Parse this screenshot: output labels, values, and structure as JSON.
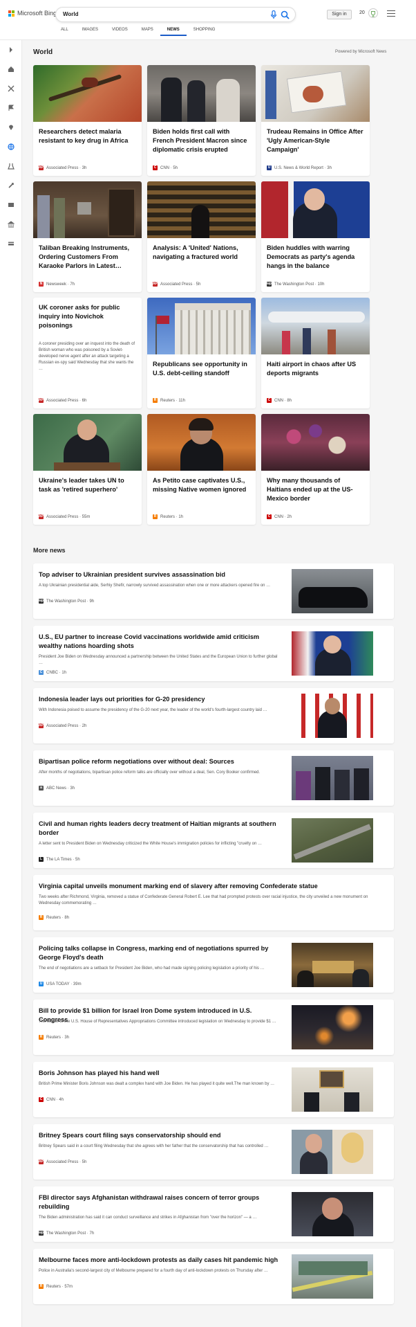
{
  "header": {
    "brand": "Microsoft Bing",
    "query": "World",
    "signin": "Sign in",
    "rewards": "20"
  },
  "tabs": [
    {
      "label": "ALL"
    },
    {
      "label": "IMAGES"
    },
    {
      "label": "VIDEOS"
    },
    {
      "label": "MAPS"
    },
    {
      "label": "NEWS"
    },
    {
      "label": "SHOPPING"
    }
  ],
  "active_tab": "NEWS",
  "section": {
    "title": "World",
    "powered": "Powered by Microsoft News"
  },
  "cards": [
    {
      "title": "Researchers detect malaria resistant to key drug in Africa",
      "source": "Associated Press · 3h",
      "logo": "AP",
      "logo_color": "#c62828"
    },
    {
      "title": "Biden holds first call with French President Macron since diplomatic crisis erupted",
      "source": "CNN · 5h",
      "logo": "CNN",
      "logo_color": "#cc0000"
    },
    {
      "title": "Trudeau Remains in Office After 'Ugly American-Style Campaign'",
      "source": "U.S. News & World Report · 3h",
      "logo": "U",
      "logo_color": "#1e3a8a"
    },
    {
      "title": "Taliban Breaking Instruments, Ordering Customers From Karaoke Parlors in Latest…",
      "source": "Newsweek · 7h",
      "logo": "N",
      "logo_color": "#d32f2f"
    },
    {
      "title": "Analysis: A 'United' Nations, navigating a fractured world",
      "source": "Associated Press · 5h",
      "logo": "AP",
      "logo_color": "#c62828"
    },
    {
      "title": "Biden huddles with warring Democrats as party's agenda hangs in the balance",
      "source": "The Washington Post · 10h",
      "logo": "wp",
      "logo_color": "#333333"
    },
    {
      "title": "UK coroner asks for public inquiry into Novichok poisonings",
      "summary": "A coroner presiding over an inquest into the death of British woman who was poisoned by a Soviet-developed nerve agent after an attack targeting a Russian ex-spy said Wednesday that she wants the …",
      "source": "Associated Press · 6h",
      "logo": "AP",
      "logo_color": "#c62828"
    },
    {
      "title": "Republicans see opportunity in U.S. debt-ceiling standoff",
      "source": "Reuters · 11h",
      "logo": "R",
      "logo_color": "#f57c00"
    },
    {
      "title": "Haiti airport in chaos after US deports migrants",
      "source": "CNN · 8h",
      "logo": "CNN",
      "logo_color": "#cc0000"
    },
    {
      "title": "Ukraine's leader takes UN to task as 'retired superhero'",
      "source": "Associated Press · 55m",
      "logo": "AP",
      "logo_color": "#c62828"
    },
    {
      "title": "As Petito case captivates U.S., missing Native women ignored",
      "source": "Reuters · 1h",
      "logo": "R",
      "logo_color": "#f57c00"
    },
    {
      "title": "Why many thousands of Haitians ended up at the US-Mexico border",
      "source": "CNN · 2h",
      "logo": "CNN",
      "logo_color": "#cc0000"
    }
  ],
  "more": {
    "title": "More news"
  },
  "rows": [
    {
      "title": "Top adviser to Ukrainian president survives assassination bid",
      "summary": "A top Ukrainian presidential aide, Serhiy Shefir, narrowly survived assassination when one or more attackers opened fire on …",
      "source": "The Washington Post · 9h",
      "logo": "wp",
      "logo_color": "#333333"
    },
    {
      "title": "U.S., EU partner to increase Covid vaccinations worldwide amid criticism wealthy nations hoarding shots",
      "summary": "President Joe Biden on Wednesday announced a partnership between the United States and the European Union to further global …",
      "source": "CNBC · 1h",
      "logo": "C",
      "logo_color": "#4a90d9"
    },
    {
      "title": "Indonesia leader lays out priorities for G-20 presidency",
      "summary": "With Indonesia poised to assume the presidency of the G-20 next year, the leader of the world's fourth-largest country laid …",
      "source": "Associated Press · 2h",
      "logo": "AP",
      "logo_color": "#c62828"
    },
    {
      "title": "Bipartisan police reform negotiations over without deal: Sources",
      "summary": "After months of negotiations, bipartisan police reform talks are officially over without a deal, Sen. Cory Booker confirmed.",
      "source": "ABC News · 3h",
      "logo": "a",
      "logo_color": "#555555"
    },
    {
      "title": "Civil and human rights leaders decry treatment of Haitian migrants at southern border",
      "summary": "A letter sent to President Biden on Wednesday criticized the White House's immigration policies for inflicting \"cruelty on …",
      "source": "The LA Times · 5h",
      "logo": "L",
      "logo_color": "#222222"
    },
    {
      "title": "Virginia capital unveils monument marking end of slavery after removing Confederate statue",
      "summary": "Two weeks after Richmond, Virginia, removed a statue of Confederate General Robert E. Lee that had prompted protests over racial injustice, the city unveiled a new monument on Wednesday commemorating …",
      "source": "Reuters · 8h",
      "logo": "R",
      "logo_color": "#f57c00"
    },
    {
      "title": "Policing talks collapse in Congress, marking end of negotiations spurred by George Floyd's death",
      "summary": "The end of negotiations are a setback for President Joe Biden, who had made signing policing legislation a priority of his …",
      "source": "USA TODAY · 39m",
      "logo": "U",
      "logo_color": "#1e88e5"
    },
    {
      "title": "Bill to provide $1 billion for Israel Iron Dome system introduced in U.S. Congress",
      "summary": "The leader of the U.S. House of Representatives Appropriations Committee introduced legislation on Wednesday to provide $1 …",
      "source": "Reuters · 3h",
      "logo": "R",
      "logo_color": "#f57c00"
    },
    {
      "title": "Boris Johnson has played his hand well",
      "summary": "British Prime Minister Boris Johnson was dealt a complex hand with Joe Biden. He has played it quite well.The man known by …",
      "source": "CNN · 4h",
      "logo": "CNN",
      "logo_color": "#cc0000"
    },
    {
      "title": "Britney Spears court filing says conservatorship should end",
      "summary": "Britney Spears said in a court filing Wednesday that she agrees with her father that the conservatorship that has controlled …",
      "source": "Associated Press · 5h",
      "logo": "AP",
      "logo_color": "#c62828"
    },
    {
      "title": "FBI director says Afghanistan withdrawal raises concern of terror groups rebuilding",
      "summary": "The Biden administration has said it can conduct surveillance and strikes in Afghanistan from \"over the horizon\" — a …",
      "source": "The Washington Post · 7h",
      "logo": "wp",
      "logo_color": "#333333"
    },
    {
      "title": "Melbourne faces more anti-lockdown protests as daily cases hit pandemic high",
      "summary": "Police in Australia's second-largest city of Melbourne prepared for a fourth day of anti-lockdown protests on Thursday after …",
      "source": "Reuters · 57m",
      "logo": "R",
      "logo_color": "#f57c00"
    }
  ]
}
